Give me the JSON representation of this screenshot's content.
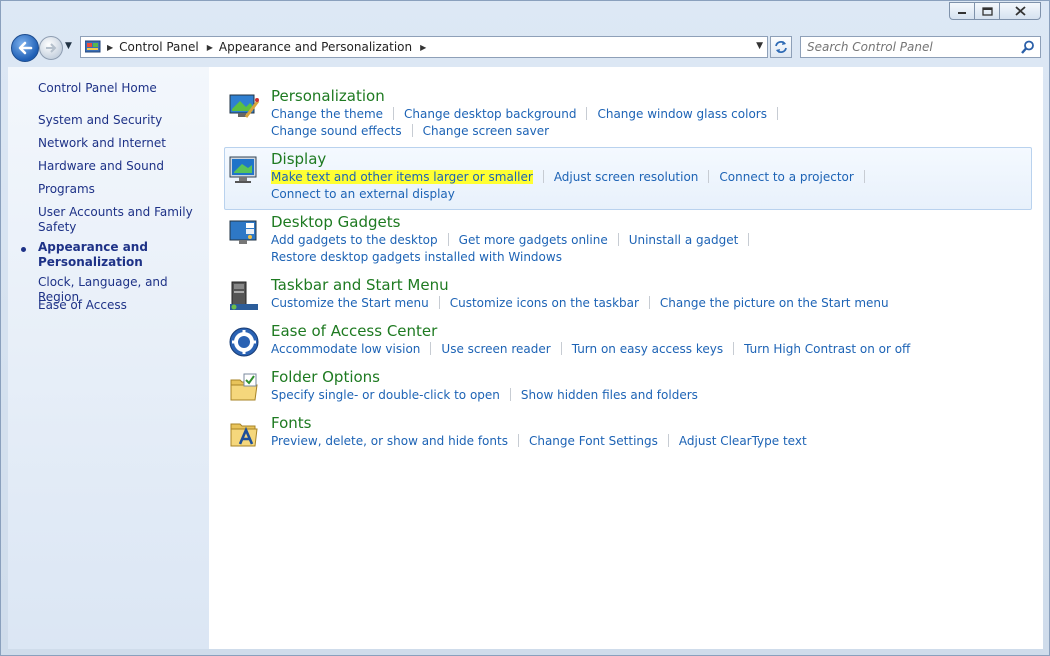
{
  "window": {
    "caption_icons": [
      "minimize-icon",
      "maximize-icon",
      "close-icon"
    ]
  },
  "address": {
    "crumbs": [
      "Control Panel",
      "Appearance and Personalization"
    ]
  },
  "search": {
    "placeholder": "Search Control Panel"
  },
  "sidebar": {
    "items": [
      {
        "label": "Control Panel Home"
      },
      {
        "label": "System and Security"
      },
      {
        "label": "Network and Internet"
      },
      {
        "label": "Hardware and Sound"
      },
      {
        "label": "Programs"
      },
      {
        "label": "User Accounts and Family Safety"
      },
      {
        "label": "Appearance and Personalization",
        "current": true
      },
      {
        "label": "Clock, Language, and Region"
      },
      {
        "label": "Ease of Access"
      }
    ]
  },
  "categories": [
    {
      "title": "Personalization",
      "icon": "personalization-icon",
      "links": [
        "Change the theme",
        "Change desktop background",
        "Change window glass colors",
        "Change sound effects",
        "Change screen saver"
      ]
    },
    {
      "title": "Display",
      "icon": "display-icon",
      "links": [
        "Make text and other items larger or smaller",
        "Adjust screen resolution",
        "Connect to a projector",
        "Connect to an external display"
      ]
    },
    {
      "title": "Desktop Gadgets",
      "icon": "gadgets-icon",
      "links": [
        "Add gadgets to the desktop",
        "Get more gadgets online",
        "Uninstall a gadget",
        "Restore desktop gadgets installed with Windows"
      ]
    },
    {
      "title": "Taskbar and Start Menu",
      "icon": "taskbar-icon",
      "links": [
        "Customize the Start menu",
        "Customize icons on the taskbar",
        "Change the picture on the Start menu"
      ]
    },
    {
      "title": "Ease of Access Center",
      "icon": "ease-of-access-icon",
      "links": [
        "Accommodate low vision",
        "Use screen reader",
        "Turn on easy access keys",
        "Turn High Contrast on or off"
      ]
    },
    {
      "title": "Folder Options",
      "icon": "folder-options-icon",
      "links": [
        "Specify single- or double-click to open",
        "Show hidden files and folders"
      ]
    },
    {
      "title": "Fonts",
      "icon": "fonts-icon",
      "links": [
        "Preview, delete, or show and hide fonts",
        "Change Font Settings",
        "Adjust ClearType text"
      ]
    }
  ],
  "colors": {
    "category_title": "#1e7a21",
    "link": "#1d63b5",
    "sidebar_link": "#1e3287",
    "highlight": "#ffff32"
  }
}
